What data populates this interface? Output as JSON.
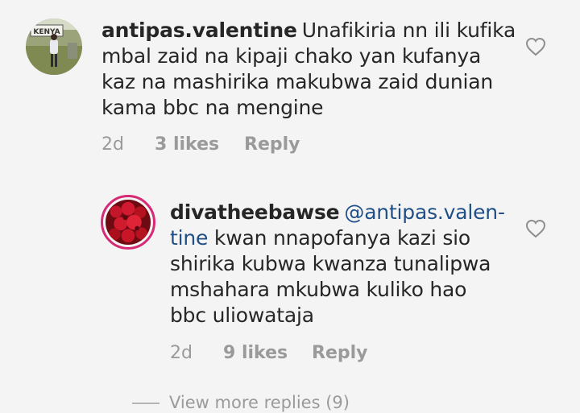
{
  "comments": [
    {
      "username": "antipas.valentine",
      "text_lines": [
        "Unafikiria nn ili kufika",
        "mbal zaid na kipaji chako yan kufanya",
        "kaz na mashirika makubwa zaid dunian",
        "kama bbc na mengine"
      ],
      "avatar_sign_text": "KENYA",
      "age": "2d",
      "likes": "3 likes",
      "reply_label": "Reply",
      "like_icon": "heart-outline-icon"
    },
    {
      "username": "divatheebawse",
      "mention_line1": "@antipas.valen-",
      "mention_line2": "tine",
      "text_line2_rest": " kwan nnapofanya kazi sio",
      "text_lines_rest": [
        "shirika kubwa kwanza tunalipwa",
        "mshahara mkubwa kuliko hao",
        "bbc uliowataja"
      ],
      "age": "2d",
      "likes": "9 likes",
      "reply_label": "Reply",
      "like_icon": "heart-outline-icon",
      "avatar_ring_color": "#d62976"
    }
  ],
  "view_more": "View more replies (9)",
  "colors": {
    "background": "#f4f4f4",
    "text": "#262626",
    "secondary": "#9a9a9a",
    "mention": "#1f4f86"
  }
}
